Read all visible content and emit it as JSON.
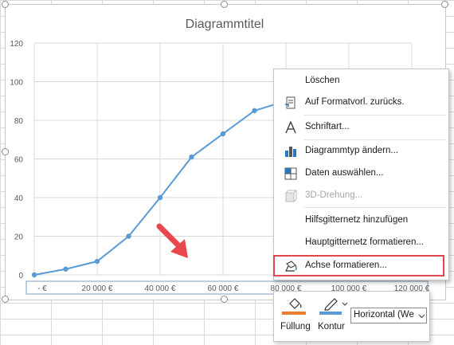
{
  "chart_data": {
    "type": "line",
    "title": "Diagrammtitel",
    "x": [
      0,
      10000,
      20000,
      30000,
      40000,
      50000,
      60000,
      70000,
      80000
    ],
    "values": [
      0,
      3,
      7,
      20,
      40,
      61,
      73,
      85,
      90
    ],
    "xlim": [
      0,
      120000
    ],
    "ylim": [
      0,
      120
    ],
    "x_tick_labels": [
      "-   €",
      "20 000 €",
      "40 000 €",
      "60 000 €",
      "80 000 €",
      "100 000 €",
      "120 000 €"
    ],
    "y_tick_labels": [
      "0",
      "20",
      "40",
      "60",
      "80",
      "100",
      "120"
    ],
    "grid": true,
    "line_color": "#5b9bd5"
  },
  "context_menu": {
    "items": [
      {
        "label": "Löschen",
        "icon": "none",
        "disabled": false
      },
      {
        "label": "Auf Formatvorl. zurücks.",
        "icon": "reset-format-icon",
        "disabled": false
      },
      {
        "label": "Schriftart...",
        "icon": "font-icon",
        "disabled": false
      },
      {
        "label": "Diagrammtyp ändern...",
        "icon": "chart-type-icon",
        "disabled": false
      },
      {
        "label": "Daten auswählen...",
        "icon": "select-data-icon",
        "disabled": false
      },
      {
        "label": "3D-Drehung...",
        "icon": "3d-rotation-icon",
        "disabled": true
      },
      {
        "label": "Hilfsgitternetz hinzufügen",
        "icon": "none",
        "disabled": false
      },
      {
        "label": "Hauptgitternetz formatieren...",
        "icon": "none",
        "disabled": false
      },
      {
        "label": "Achse formatieren...",
        "icon": "format-axis-icon",
        "disabled": false
      }
    ]
  },
  "mini_toolbar": {
    "fill_label": "Füllung",
    "outline_label": "Kontur",
    "element_select_value": "Horizontal (We",
    "fill_color": "#ed7d31",
    "outline_color": "#5b9bd5"
  },
  "annotation": {
    "arrow_color": "#e8474c",
    "highlight_color": "#e0474c"
  }
}
